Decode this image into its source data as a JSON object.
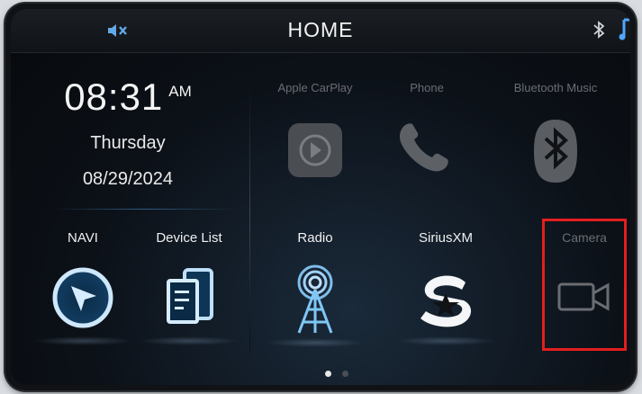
{
  "header": {
    "title": "HOME",
    "mute_icon": "speaker-mute-icon",
    "bluetooth_icon": "bluetooth-icon",
    "music_icon": "music-note-icon"
  },
  "clock": {
    "time": "08:31",
    "ampm": "AM",
    "day": "Thursday",
    "date": "08/29/2024"
  },
  "tiles": {
    "apple_carplay": {
      "label": "Apple CarPlay",
      "icon": "carplay-icon"
    },
    "phone": {
      "label": "Phone",
      "icon": "phone-handset-icon"
    },
    "bluetooth_music": {
      "label": "Bluetooth Music",
      "icon": "bluetooth-icon"
    },
    "navi": {
      "label": "NAVI",
      "icon": "navigation-arrow-icon"
    },
    "device_list": {
      "label": "Device List",
      "icon": "device-list-icon"
    },
    "radio": {
      "label": "Radio",
      "icon": "radio-antenna-icon"
    },
    "siriusxm": {
      "label": "SiriusXM",
      "icon": "siriusxm-logo-icon"
    },
    "camera": {
      "label": "Camera",
      "icon": "video-camera-icon"
    }
  },
  "pager": {
    "pages": 2,
    "current": 1
  },
  "colors": {
    "accent_blue": "#4fa6ff",
    "highlight_red": "#e41e1e",
    "dim_gray": "#6a6d72"
  }
}
